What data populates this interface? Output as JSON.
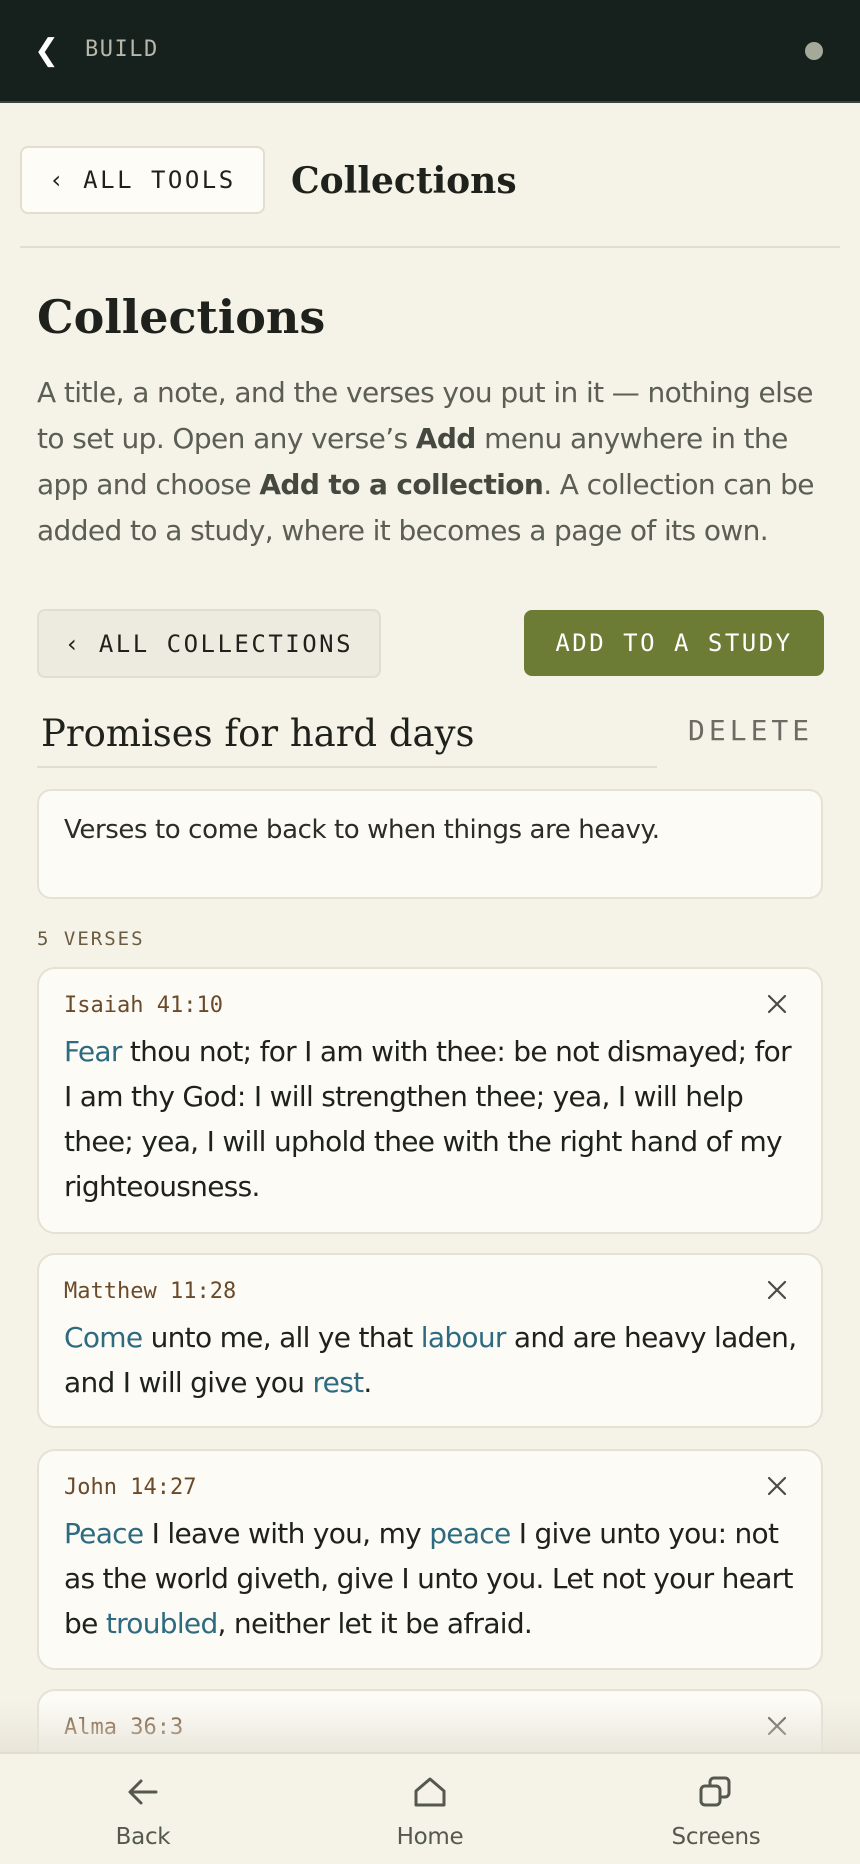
{
  "topbar": {
    "title": "BUILD"
  },
  "header": {
    "back_label": "‹  ALL TOOLS",
    "title": "Collections"
  },
  "page": {
    "heading": "Collections",
    "intro": {
      "p1": "A title, a note, and the verses you put in it — nothing else to set up. Open any verse’s ",
      "b1": "Add",
      "p2": " menu anywhere in the app and choose ",
      "b2": "Add to a collection",
      "p3": ". A collection can be added to a study, where it becomes a page of its own."
    }
  },
  "actions": {
    "all_collections": "‹  ALL COLLECTIONS",
    "add_to_study": "ADD TO A STUDY"
  },
  "collection": {
    "title": "Promises for hard days",
    "delete_label": "DELETE",
    "note": "Verses to come back to when things are heavy.",
    "verse_count": "5 VERSES",
    "verses": [
      {
        "ref": "Isaiah 41:10",
        "segments": [
          {
            "t": "Fear",
            "k": true
          },
          {
            "t": " thou not; for I am with thee: be not dismayed; for I am thy God: I will strengthen thee; yea, I will help thee; yea, I will uphold thee with the right hand of my righteousness.",
            "k": false
          }
        ]
      },
      {
        "ref": "Matthew 11:28",
        "segments": [
          {
            "t": "Come",
            "k": true
          },
          {
            "t": " unto me, all ye that ",
            "k": false
          },
          {
            "t": "labour",
            "k": true
          },
          {
            "t": " and are heavy laden, and I will give you ",
            "k": false
          },
          {
            "t": "rest",
            "k": true
          },
          {
            "t": ".",
            "k": false
          }
        ]
      },
      {
        "ref": "John 14:27",
        "segments": [
          {
            "t": "Peace",
            "k": true
          },
          {
            "t": " I leave with you, my ",
            "k": false
          },
          {
            "t": "peace",
            "k": true
          },
          {
            "t": " I give unto you: not as the world giveth, give I unto you. Let not your heart be ",
            "k": false
          },
          {
            "t": "troubled",
            "k": true
          },
          {
            "t": ", neither let it be afraid.",
            "k": false
          }
        ]
      },
      {
        "ref": "Alma 36:3",
        "segments": []
      }
    ]
  },
  "bottom_nav": [
    {
      "label": "Back",
      "icon": "arrow-left-icon"
    },
    {
      "label": "Home",
      "icon": "home-icon"
    },
    {
      "label": "Screens",
      "icon": "screens-icon"
    }
  ],
  "colors": {
    "topbar_bg": "#16211d",
    "page_bg": "#f5f2e7",
    "accent_green": "#6c7c35",
    "keyword_blue": "#2e6b80",
    "reference_brown": "#6b4a2a"
  }
}
